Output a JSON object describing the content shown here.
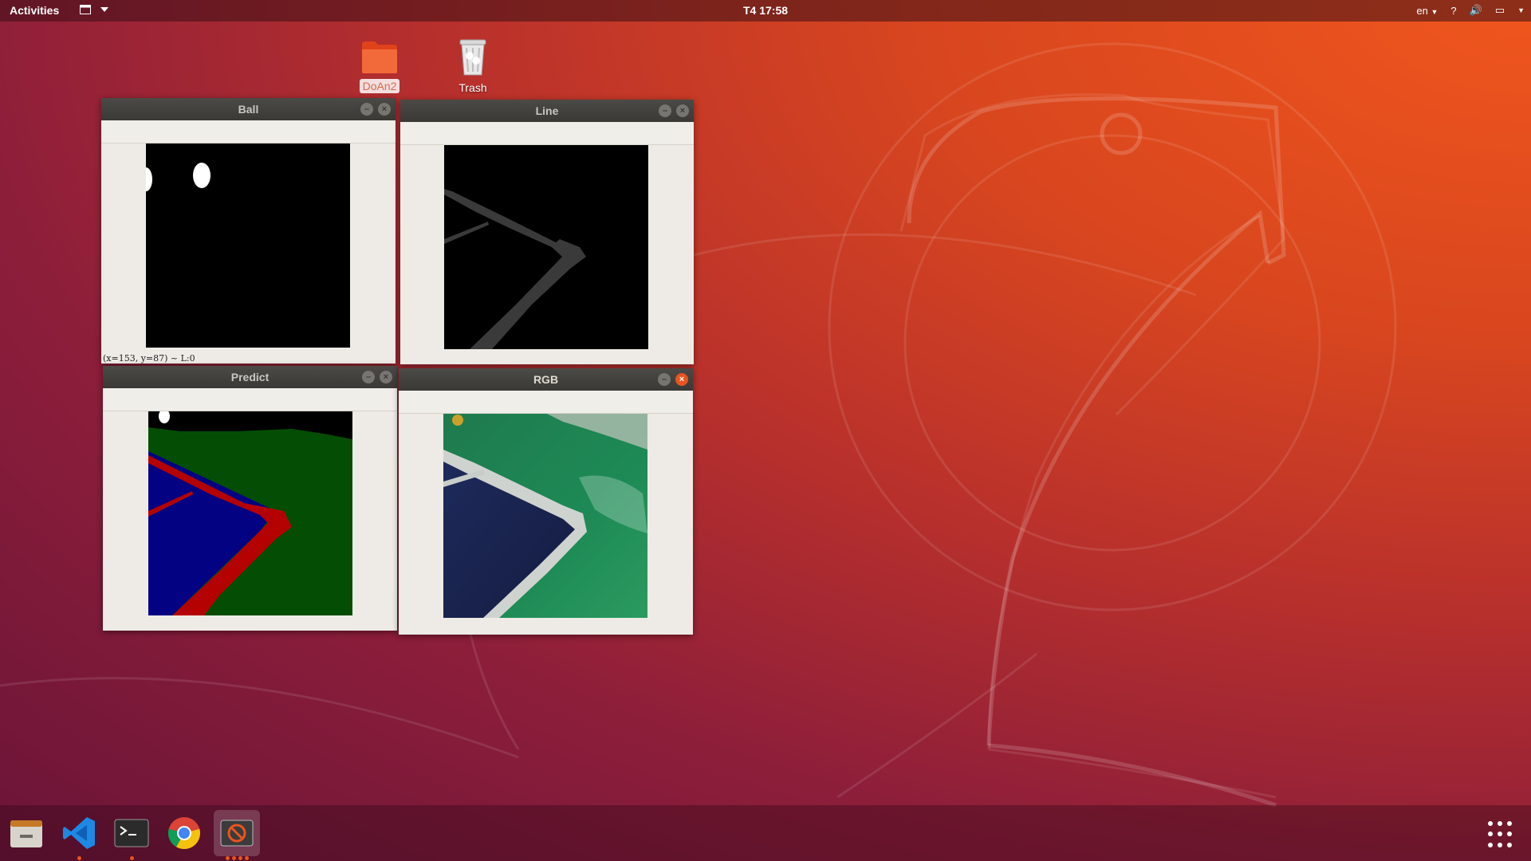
{
  "topbar": {
    "activities": "Activities",
    "clock": "T4 17:58",
    "language": "en",
    "help": "?"
  },
  "desktop": {
    "icons": [
      {
        "label": "DoAn2",
        "icon": "folder-icon"
      },
      {
        "label": "Trash",
        "icon": "trash-icon"
      }
    ]
  },
  "windows": {
    "ball": {
      "title": "Ball",
      "status": "(x=153, y=87) ~ L:0"
    },
    "line": {
      "title": "Line"
    },
    "predict": {
      "title": "Predict"
    },
    "rgb": {
      "title": "RGB"
    }
  },
  "dock": {
    "items": [
      "files-icon",
      "vscode-icon",
      "terminal-icon",
      "chrome-icon",
      "python-app-icon"
    ],
    "show_apps": "show-applications-icon"
  },
  "colors": {
    "accent": "#e95420",
    "titlebar": "#3c3b37",
    "window_bg": "#eeebe6"
  }
}
